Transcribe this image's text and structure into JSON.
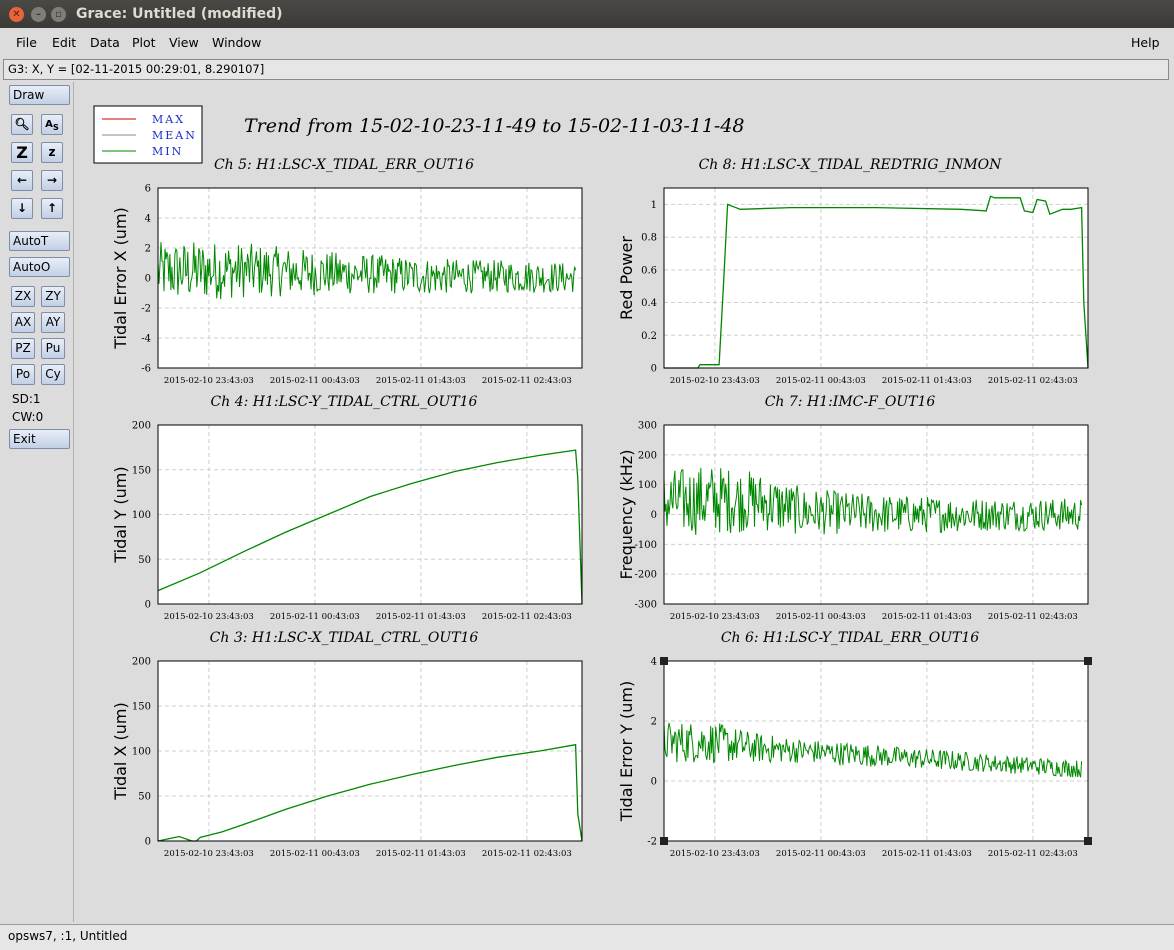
{
  "window": {
    "title": "Grace: Untitled (modified)"
  },
  "menu": {
    "file": "File",
    "edit": "Edit",
    "data": "Data",
    "plot": "Plot",
    "view": "View",
    "window": "Window",
    "help": "Help"
  },
  "locator": "G3: X, Y = [02-11-2015 00:29:01, 8.290107]",
  "toolbar": {
    "draw": "Draw",
    "autot": "AutoT",
    "autoo": "AutoO",
    "zx": "ZX",
    "zy": "ZY",
    "ax": "AX",
    "ay": "AY",
    "pz": "PZ",
    "pu": "Pu",
    "po": "Po",
    "cy": "Cy",
    "sd": "SD:1",
    "cw": "CW:0",
    "exit": "Exit"
  },
  "legend": [
    {
      "label": "MAX",
      "color": "#cc0000"
    },
    {
      "label": "MEAN",
      "color": "#888888"
    },
    {
      "label": "MIN",
      "color": "#008800"
    }
  ],
  "main_title": "Trend from 15-02-10-23-11-49 to 15-02-11-03-11-48",
  "status_bottom": "opsws7, :1, Untitled",
  "chart_data": [
    {
      "type": "line",
      "title": "Ch 5: H1:LSC-X_TIDAL_ERR_OUT16",
      "ylabel": "Tidal Error X (um)",
      "ylim": [
        -6,
        6
      ],
      "yticks": [
        "6",
        "4",
        "2",
        "0",
        "-2",
        "-4",
        "-6"
      ],
      "xticks": [
        "2015-02-10 23:43:03",
        "2015-02-11 00:43:03",
        "2015-02-11 01:43:03",
        "2015-02-11 02:43:03"
      ],
      "mean": [
        0.4,
        0.5,
        0.5,
        0.4,
        0.3,
        0.2,
        0.1,
        0.1,
        0.1,
        0.0
      ],
      "spread": [
        2.0,
        2.0,
        1.8,
        1.6,
        1.4,
        1.3,
        1.2,
        1.1,
        1.1,
        1.0
      ],
      "grid": true
    },
    {
      "type": "line",
      "title": "Ch 8: H1:LSC-X_TIDAL_REDTRIG_INMON",
      "ylabel": "Red Power",
      "ylim": [
        0,
        1.1
      ],
      "yticks": [
        "1",
        "0.8",
        "0.6",
        "0.4",
        "0.2",
        "0"
      ],
      "xticks": [
        "2015-02-10 23:43:03",
        "2015-02-11 00:43:03",
        "2015-02-11 01:43:03",
        "2015-02-11 02:43:03"
      ],
      "x": [
        0,
        0.08,
        0.085,
        0.13,
        0.14,
        0.15,
        0.18,
        0.3,
        0.5,
        0.7,
        0.76,
        0.77,
        0.78,
        0.84,
        0.85,
        0.87,
        0.88,
        0.9,
        0.91,
        0.93,
        0.94,
        0.96,
        0.985,
        0.99,
        1.0
      ],
      "y": [
        0.0,
        0.0,
        0.02,
        0.02,
        0.5,
        1.0,
        0.97,
        0.98,
        0.98,
        0.97,
        0.96,
        1.05,
        1.04,
        1.04,
        0.96,
        0.95,
        1.03,
        1.02,
        0.94,
        0.96,
        0.97,
        0.97,
        0.98,
        0.4,
        0.0
      ],
      "grid": true
    },
    {
      "type": "line",
      "title": "Ch 4: H1:LSC-Y_TIDAL_CTRL_OUT16",
      "ylabel": "Tidal Y (um)",
      "ylim": [
        0,
        200
      ],
      "yticks": [
        "200",
        "150",
        "100",
        "50",
        "0"
      ],
      "xticks": [
        "2015-02-10 23:43:03",
        "2015-02-11 00:43:03",
        "2015-02-11 01:43:03",
        "2015-02-11 02:43:03"
      ],
      "x": [
        0,
        0.1,
        0.2,
        0.3,
        0.4,
        0.5,
        0.6,
        0.7,
        0.8,
        0.9,
        0.985,
        0.99,
        1.0
      ],
      "y": [
        15,
        35,
        58,
        80,
        100,
        120,
        135,
        148,
        158,
        166,
        172,
        140,
        0
      ],
      "grid": true
    },
    {
      "type": "line",
      "title": "Ch 7: H1:IMC-F_OUT16",
      "ylabel": "Frequency (kHz)",
      "ylim": [
        -300,
        300
      ],
      "yticks": [
        "300",
        "200",
        "100",
        "0",
        "-100",
        "-200",
        "-300"
      ],
      "xticks": [
        "2015-02-10 23:43:03",
        "2015-02-11 00:43:03",
        "2015-02-11 01:43:03",
        "2015-02-11 02:43:03"
      ],
      "mean": [
        40,
        50,
        45,
        10,
        5,
        0,
        0,
        0,
        0,
        0
      ],
      "spread": [
        110,
        120,
        100,
        80,
        70,
        65,
        60,
        55,
        55,
        55
      ],
      "grid": true
    },
    {
      "type": "line",
      "title": "Ch 3: H1:LSC-X_TIDAL_CTRL_OUT16",
      "ylabel": "Tidal X (um)",
      "ylim": [
        0,
        200
      ],
      "yticks": [
        "200",
        "150",
        "100",
        "50",
        "0"
      ],
      "xticks": [
        "2015-02-10 23:43:03",
        "2015-02-11 00:43:03",
        "2015-02-11 01:43:03",
        "2015-02-11 02:43:03"
      ],
      "x": [
        0,
        0.05,
        0.08,
        0.09,
        0.1,
        0.15,
        0.2,
        0.3,
        0.4,
        0.5,
        0.6,
        0.7,
        0.8,
        0.9,
        0.985,
        0.99,
        1.0
      ],
      "y": [
        0,
        5,
        0,
        0,
        4,
        10,
        18,
        35,
        50,
        63,
        74,
        84,
        93,
        100,
        107,
        30,
        0
      ],
      "grid": true
    },
    {
      "type": "line",
      "title": "Ch 6: H1:LSC-Y_TIDAL_ERR_OUT16",
      "ylabel": "Tidal Error Y (um)",
      "ylim": [
        -2,
        4
      ],
      "yticks": [
        "4",
        "2",
        "0",
        "-2"
      ],
      "xticks": [
        "2015-02-10 23:43:03",
        "2015-02-11 00:43:03",
        "2015-02-11 01:43:03",
        "2015-02-11 02:43:03"
      ],
      "mean": [
        1.3,
        1.3,
        1.1,
        1.0,
        0.9,
        0.8,
        0.7,
        0.6,
        0.5,
        0.4
      ],
      "spread": [
        0.7,
        0.7,
        0.5,
        0.4,
        0.4,
        0.35,
        0.35,
        0.3,
        0.3,
        0.3
      ],
      "grid": true
    }
  ]
}
